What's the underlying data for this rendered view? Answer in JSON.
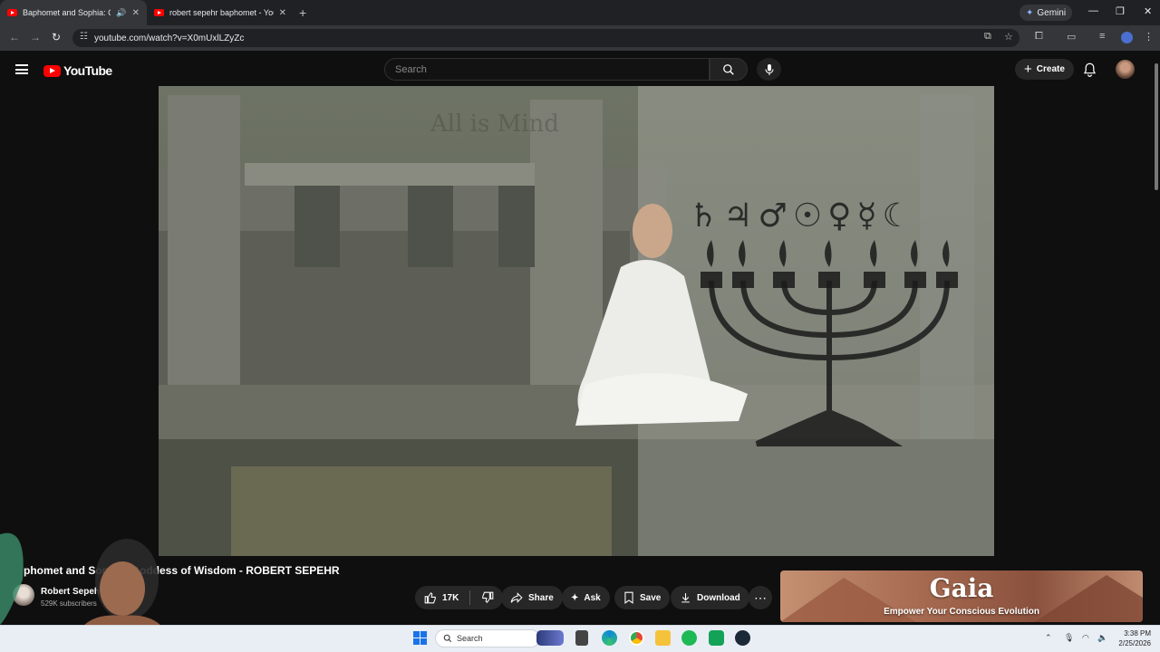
{
  "browser": {
    "tabs": [
      {
        "title": "Baphomet and Sophia: Goddess of Wisdom",
        "active": true,
        "audio": true
      },
      {
        "title": "robert sepehr baphomet - YouTube",
        "active": false,
        "audio": false
      }
    ],
    "gemini_label": "Gemini",
    "url": "youtube.com/watch?v=X0mUxlLZyZc"
  },
  "youtube": {
    "logo_text": "YouTube",
    "search_placeholder": "Search",
    "create_label": "Create"
  },
  "video": {
    "title": "phomet and Sophia: Goddess of Wisdom - ROBERT SEPEHR",
    "channel_name": "Robert Sepehr",
    "subscribers": "529K subscribers",
    "like_count": "17K",
    "share_label": "Share",
    "ask_label": "Ask",
    "save_label": "Save",
    "download_label": "Download",
    "overlay_text": "All is Mind",
    "planet_symbols": "♄♃♂☉♀☿☾"
  },
  "ad": {
    "brand": "Gaia",
    "tagline": "Empower Your Conscious Evolution"
  },
  "taskbar": {
    "search_label": "Search",
    "time": "3:38 PM",
    "date": "2/25/2026"
  },
  "colors": {
    "youtube_red": "#ff0000",
    "background": "#0f0f0f",
    "chrome_dark": "#202124"
  }
}
